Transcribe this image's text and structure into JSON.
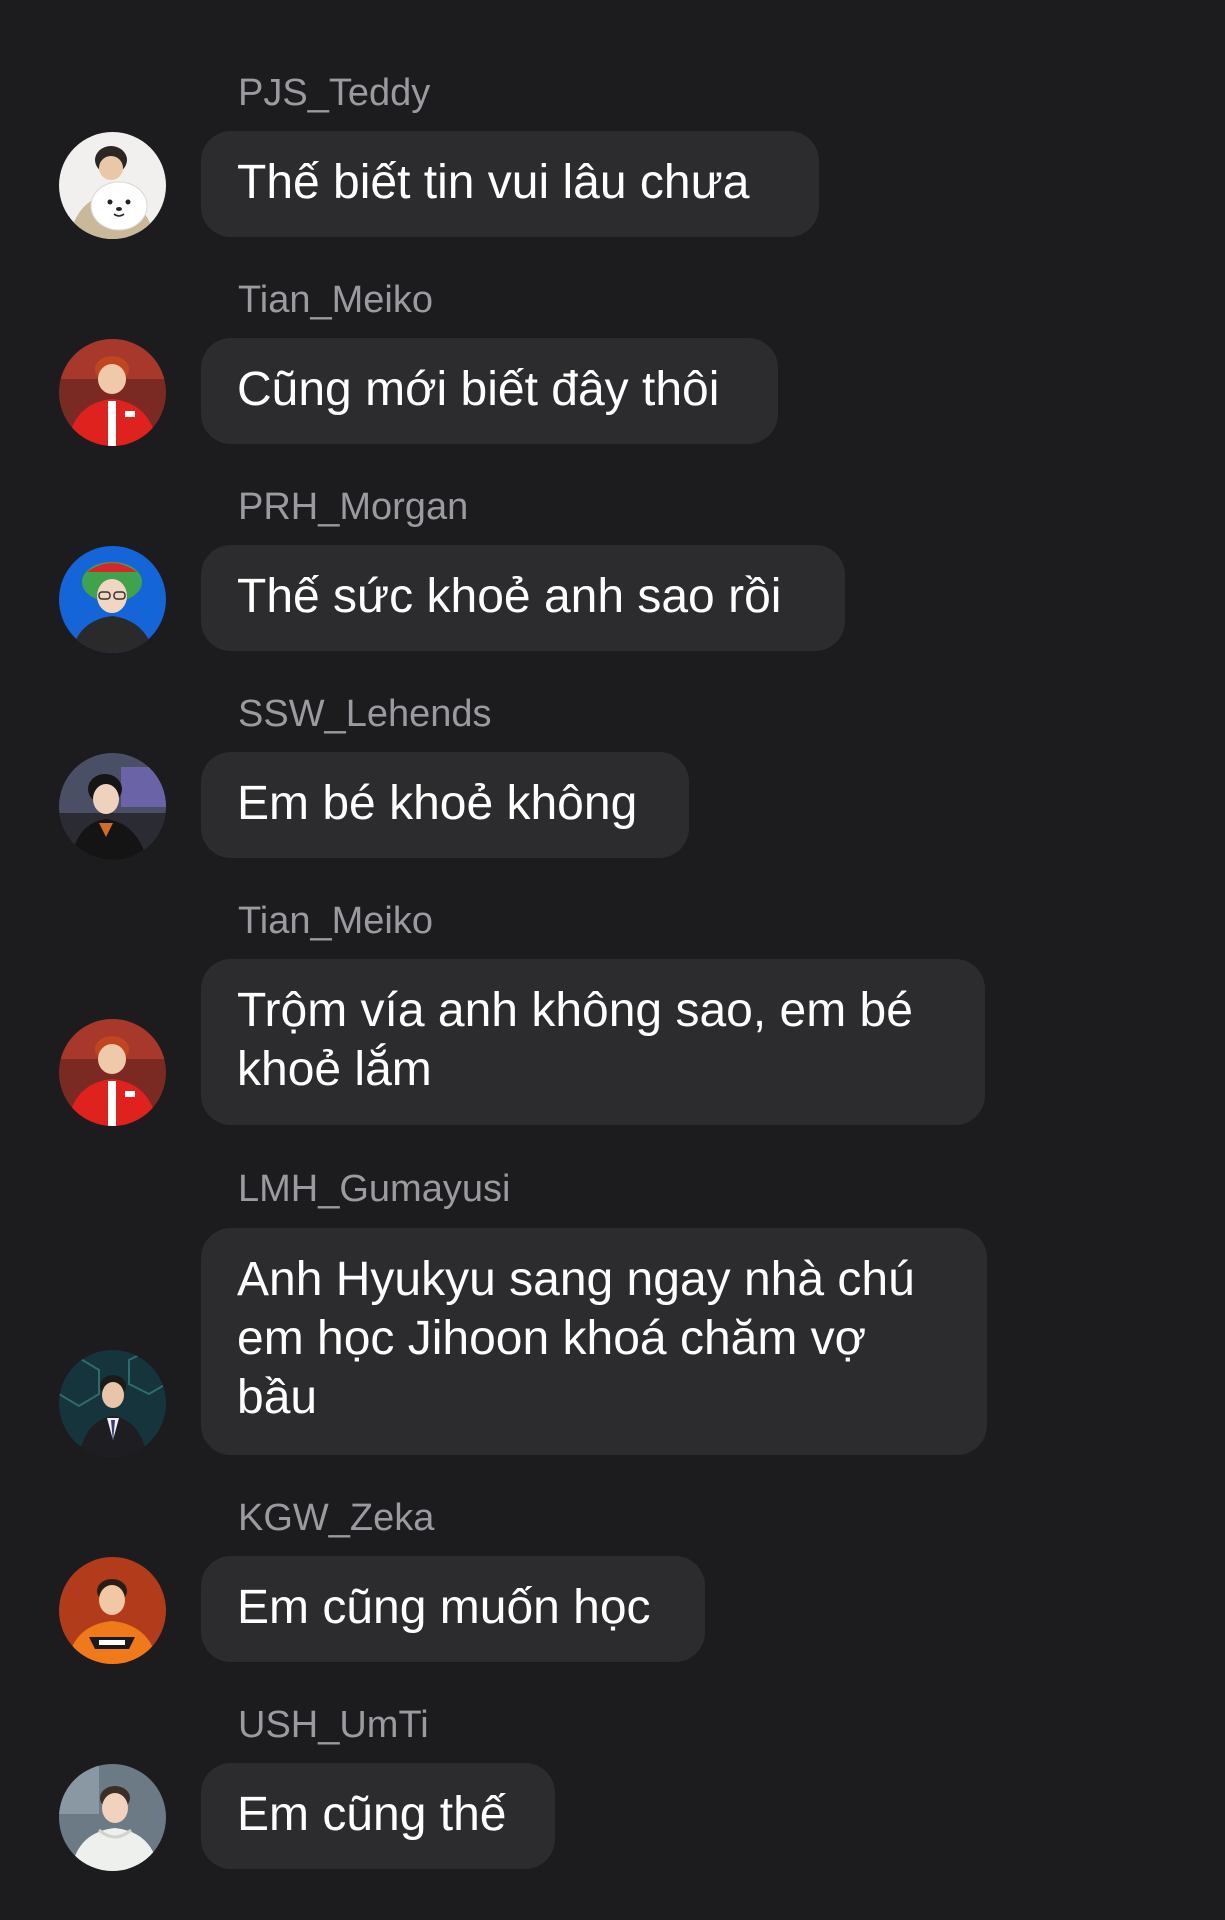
{
  "messages": [
    {
      "sender": "PJS_Teddy",
      "text": "Thế biết tin vui lâu chưa",
      "avatar": "person-holding-plush-avatar"
    },
    {
      "sender": "Tian_Meiko",
      "text": "Cũng mới biết đây thôi",
      "avatar": "person-red-jersey-avatar"
    },
    {
      "sender": "PRH_Morgan",
      "text": "Thế sức khoẻ anh sao rồi",
      "avatar": "person-green-hat-avatar"
    },
    {
      "sender": "SSW_Lehends",
      "text": "Em bé khoẻ không",
      "avatar": "person-dark-jacket-avatar"
    },
    {
      "sender": "Tian_Meiko",
      "text": "Trộm vía anh không sao, em bé\nkhoẻ lắm",
      "avatar": "person-red-jersey-avatar"
    },
    {
      "sender": "LMH_Gumayusi",
      "text": "Anh Hyukyu sang ngay nhà chú\nem học Jihoon khoá chăm vợ\nbầu",
      "avatar": "person-suit-avatar"
    },
    {
      "sender": "KGW_Zeka",
      "text": "Em cũng muốn học",
      "avatar": "person-orange-jersey-avatar"
    },
    {
      "sender": "USH_UmTi",
      "text": "Em cũng thế",
      "avatar": "person-white-hoodie-avatar"
    }
  ],
  "colors": {
    "background": "#1c1c1e",
    "bubble": "#2c2c2e",
    "sender_text": "#9a9aa0",
    "message_text": "#ffffff"
  }
}
